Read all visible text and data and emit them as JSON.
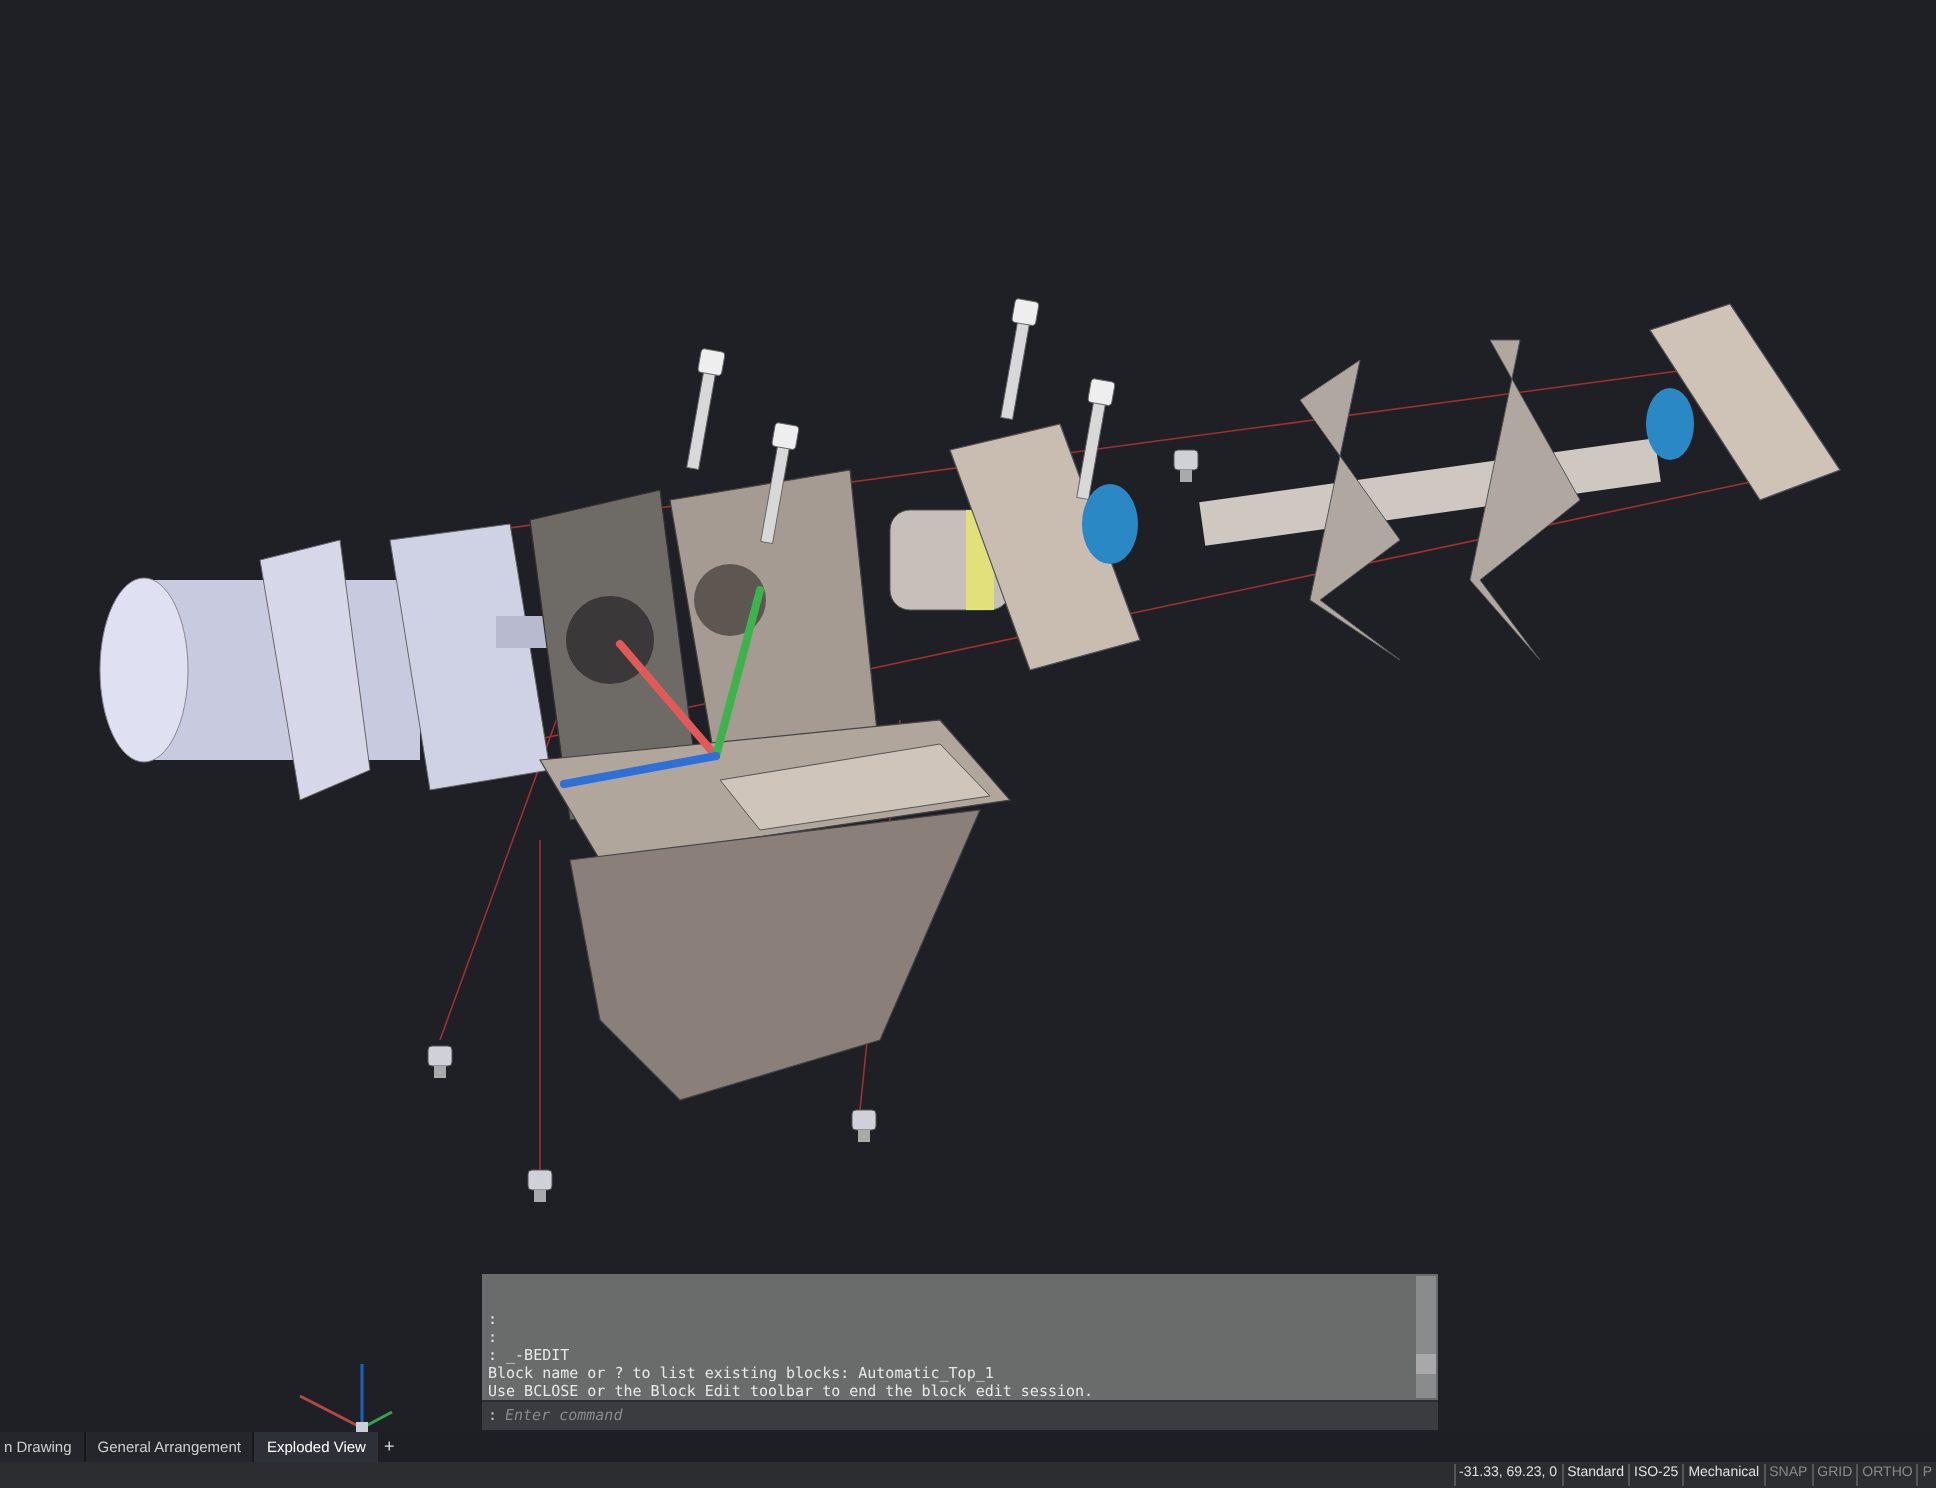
{
  "command_window": {
    "history": [
      ":",
      ":",
      ": _-BEDIT",
      "Block name or ? to list existing blocks: Automatic_Top_1",
      "Use BCLOSE or the Block Edit toolbar to end the block edit session."
    ],
    "prompt": ":",
    "placeholder": "Enter command"
  },
  "layout_tabs": [
    {
      "label": "n Drawing",
      "selected": false
    },
    {
      "label": "General Arrangement",
      "selected": false
    },
    {
      "label": "Exploded View",
      "selected": true
    }
  ],
  "add_tab": "+",
  "status_bar": [
    {
      "kind": "text",
      "label": "-31.33, 69.23, 0"
    },
    {
      "kind": "text",
      "label": "Standard"
    },
    {
      "kind": "text",
      "label": "ISO-25"
    },
    {
      "kind": "text",
      "label": "Mechanical"
    },
    {
      "kind": "toggle",
      "label": "SNAP",
      "on": false
    },
    {
      "kind": "toggle",
      "label": "GRID",
      "on": false
    },
    {
      "kind": "toggle",
      "label": "ORTHO",
      "on": false
    },
    {
      "kind": "toggle",
      "label": "P",
      "on": false
    }
  ]
}
